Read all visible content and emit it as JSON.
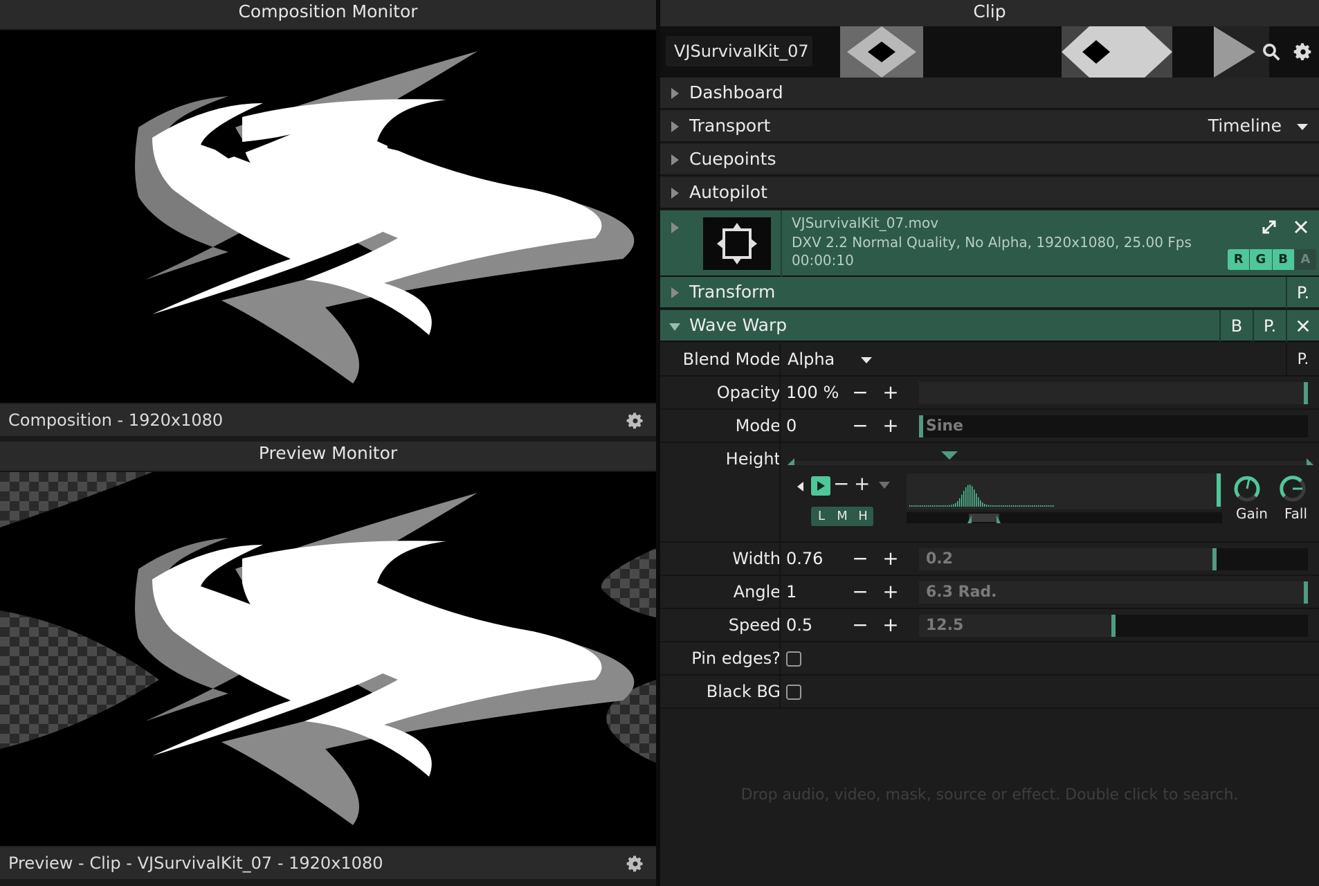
{
  "composition_monitor": {
    "title": "Composition Monitor",
    "footer_label": "Composition - 1920x1080"
  },
  "preview_monitor": {
    "title": "Preview Monitor",
    "footer_label": "Preview - Clip - VJSurvivalKit_07 - 1920x1080"
  },
  "clip_panel": {
    "title": "Clip",
    "clip_name": "VJSurvivalKit_07",
    "sections": {
      "dashboard": "Dashboard",
      "transport": "Transport",
      "transport_mode": "Timeline",
      "cuepoints": "Cuepoints",
      "autopilot": "Autopilot",
      "transform": "Transform",
      "wave_warp": "Wave Warp"
    },
    "file": {
      "name": "VJSurvivalKit_07.mov",
      "details": "DXV 2.2 Normal Quality, No Alpha, 1920x1080, 25.00 Fps",
      "duration": "00:00:10",
      "channels": [
        "R",
        "G",
        "B",
        "A"
      ]
    },
    "buttons": {
      "p": "P.",
      "b": "B"
    },
    "params": {
      "blend_mode": {
        "label": "Blend Mode",
        "value": "Alpha"
      },
      "opacity": {
        "label": "Opacity",
        "value": "100 %",
        "fraction": 1.0
      },
      "mode": {
        "label": "Mode",
        "value": "0",
        "slider_text": "Sine",
        "fraction": 0.0
      },
      "height": {
        "label": "Height",
        "bands": [
          "L",
          "M",
          "H"
        ],
        "gain_label": "Gain",
        "fall_label": "Fall"
      },
      "width": {
        "label": "Width",
        "value": "0.76",
        "slider_text": "0.2",
        "fraction": 0.76
      },
      "angle": {
        "label": "Angle",
        "value": "1",
        "slider_text": "6.3 Rad.",
        "fraction": 1.0
      },
      "speed": {
        "label": "Speed",
        "value": "0.5",
        "slider_text": "12.5",
        "fraction": 0.5
      },
      "pin_edges": {
        "label": "Pin edges?",
        "checked": false
      },
      "black_bg": {
        "label": "Black BG",
        "checked": false
      }
    },
    "drop_hint": "Drop audio, video, mask, source or effect. Double click to search."
  },
  "colors": {
    "accent": "#4f9c80",
    "header_green": "#2e5a4a"
  }
}
